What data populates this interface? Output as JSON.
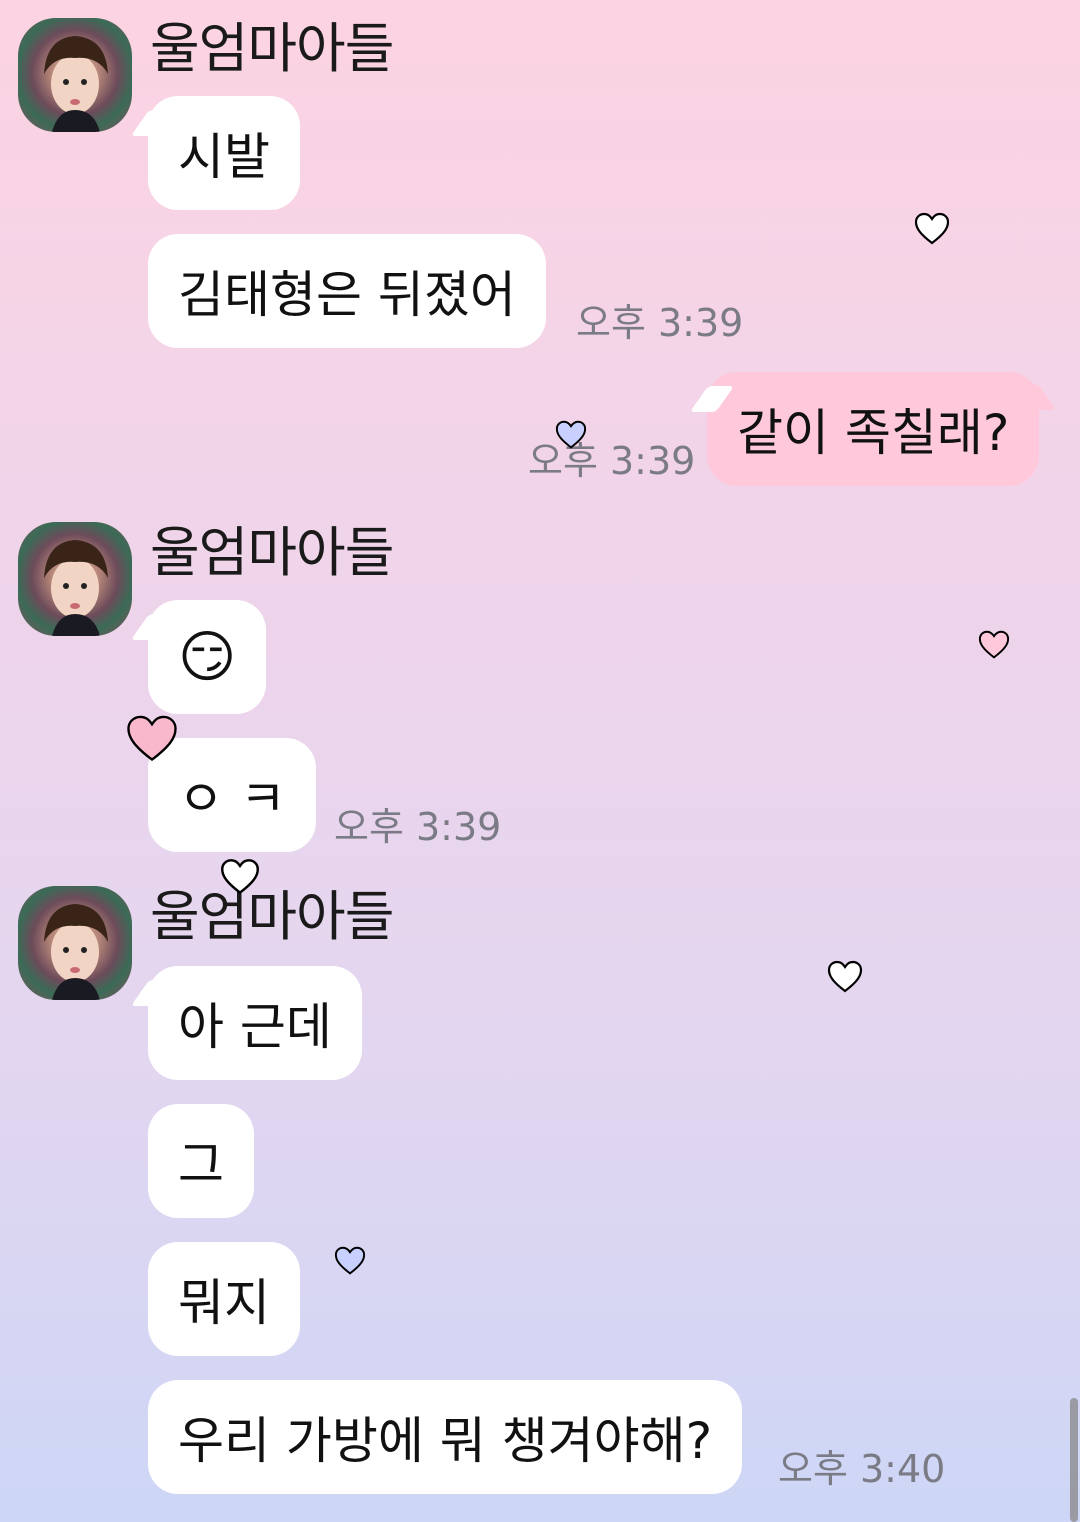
{
  "chat": {
    "groups": [
      {
        "sender": "울엄마아들",
        "messages": [
          "시발",
          "김태형은 뒤졌어"
        ],
        "time": "오후 3:39"
      },
      {
        "mine": true,
        "messages": [
          "같이 족칠래?"
        ],
        "time": "오후 3:39"
      },
      {
        "sender": "울엄마아들",
        "messages": [
          "😏",
          "ㅇ ㅋ"
        ],
        "time": "오후 3:39"
      },
      {
        "sender": "울엄마아들",
        "messages": [
          "아 근데",
          "그",
          "뭐지",
          "우리 가방에 뭐 챙겨야해?"
        ],
        "time": "오후 3:40"
      }
    ]
  },
  "colors": {
    "my_bubble": "#ffc9db",
    "other_bubble": "#ffffff",
    "time_text": "#7b7b86"
  },
  "icons": [
    "avatar-photo",
    "heart-icon"
  ]
}
